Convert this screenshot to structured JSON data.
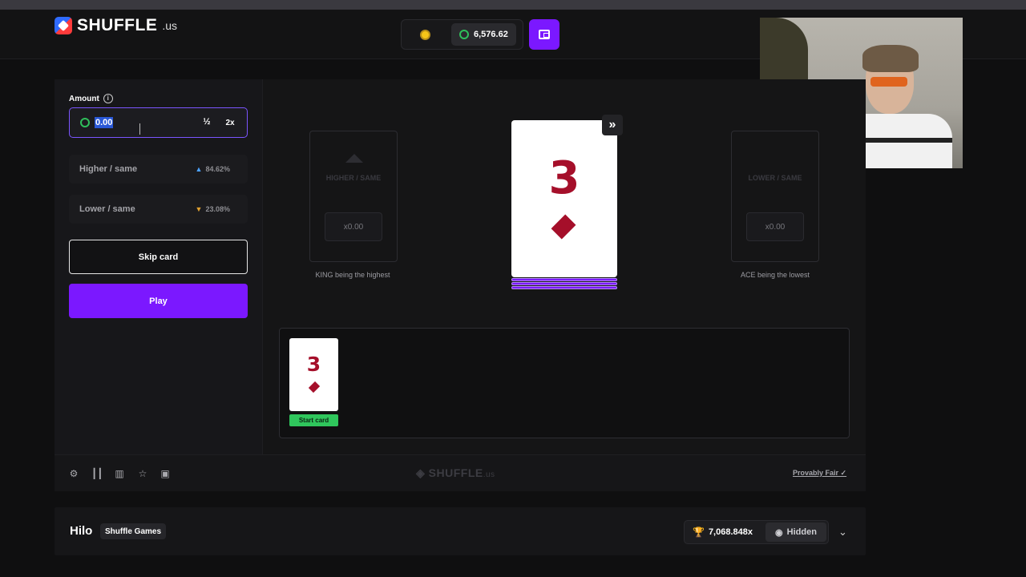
{
  "header": {
    "logo_text": "SHUFFLE",
    "logo_tld": ".us",
    "balance": "6,576.62"
  },
  "bet": {
    "amount_label": "Amount",
    "amount_value": "0.00",
    "half_label": "½",
    "double_label": "2x"
  },
  "options": [
    {
      "label": "Higher / same",
      "pct": "84.62%"
    },
    {
      "label": "Lower / same",
      "pct": "23.08%"
    }
  ],
  "buttons": {
    "skip": "Skip card",
    "play": "Play"
  },
  "slots": {
    "higher": {
      "title": "HIGHER / SAME",
      "mult": "x0.00",
      "caption": "KING being the highest"
    },
    "lower": {
      "title": "LOWER / SAME",
      "mult": "x0.00",
      "caption": "ACE being the lowest"
    }
  },
  "current_card": {
    "rank": "3",
    "suit": "diamonds"
  },
  "history": [
    {
      "rank": "3",
      "suit": "diamonds",
      "tag": "Start card"
    }
  ],
  "footer": {
    "logo_text": "SHUFFLE",
    "logo_tld": ".us",
    "provably_fair": "Provably Fair",
    "icons": [
      "settings-icon",
      "bar-chart-icon",
      "stats-icon",
      "star-icon",
      "briefcase-icon"
    ]
  },
  "game": {
    "title": "Hilo",
    "provider": "Shuffle Games",
    "top_multiplier": "7,068.848x",
    "user_label": "Hidden"
  },
  "colors": {
    "accent": "#7b18ff",
    "card_red": "#a50f2a",
    "start_green": "#2fc65c"
  }
}
